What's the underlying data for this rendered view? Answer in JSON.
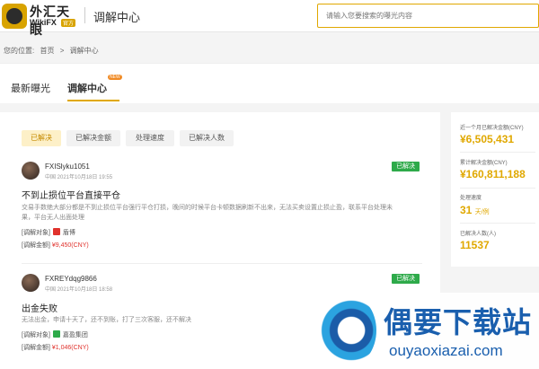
{
  "header": {
    "logo_cn": "外汇天眼",
    "logo_en": "WikiFX",
    "logo_badge": "官方",
    "title": "调解中心",
    "search_placeholder": "请输入您要搜索的曝光内容"
  },
  "breadcrumb": {
    "prefix": "您的位置:",
    "home": "首页",
    "sep": ">",
    "current": "调解中心"
  },
  "tabs": [
    {
      "label": "最新曝光",
      "active": false
    },
    {
      "label": "调解中心",
      "active": true,
      "badge": "NEW"
    }
  ],
  "filters": [
    {
      "label": "已解决",
      "active": true
    },
    {
      "label": "已解决金额",
      "active": false
    },
    {
      "label": "处理速度",
      "active": false
    },
    {
      "label": "已解决人数",
      "active": false
    }
  ],
  "complaints": [
    {
      "user": "FXISlyku1051",
      "meta": "中国  2021年10月18日 19:55",
      "status": "已解决",
      "title": "不到止损位平台直接平仓",
      "desc": "交易手数绝大部分都是不到止损位平台强行平仓打损，晚间的时候平台卡顿数据刷新不出来，无法买卖设置止损止盈，联系平台处理未果，平台无人出面处理",
      "target_label": "[调解对象]",
      "target": "盾博",
      "amount_label": "[调解金额]",
      "amount": "¥9,450(CNY)"
    },
    {
      "user": "FXREYdqg9866",
      "meta": "中国  2021年10月18日 18:58",
      "status": "已解决",
      "title": "出金失败",
      "desc": "无法出金，申请十天了，还不到账，打了三次客服，还不解决",
      "target_label": "[调解对象]",
      "target": "嘉盈集团",
      "amount_label": "[调解金额]",
      "amount": "¥1,046(CNY)"
    }
  ],
  "stats": {
    "month_amount_label": "近一个月已解决金额(CNY)",
    "month_amount": "¥6,505,431",
    "total_amount_label": "累计解决金额(CNY)",
    "total_amount": "¥160,811,188",
    "speed_label": "处理速度",
    "speed_value": "31",
    "speed_unit": "天/例",
    "people_label": "已解决人数(人)",
    "people_value": "11537"
  },
  "watermark": {
    "cn": "偶要下载站",
    "en": "ouyaoxiazai.com"
  },
  "colors": {
    "accent": "#e0a800",
    "resolved": "#2eaa4a",
    "amount": "#e0322c"
  }
}
